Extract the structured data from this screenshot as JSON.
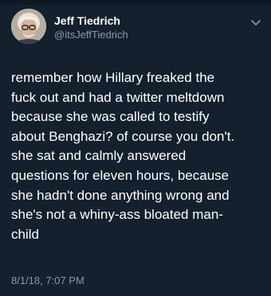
{
  "author": {
    "display_name": "Jeff Tiedrich",
    "handle": "@itsJeffTiedrich"
  },
  "tweet": {
    "lines": [
      "remember how Hillary freaked the",
      "fuck out and had a twitter meltdown",
      "because she was called to testify",
      "about Benghazi? of course you don't.",
      "she sat and calmly answered",
      "questions for eleven hours, because",
      "she hadn't done anything wrong and",
      "she's not a whiny-ass bloated man-",
      "child"
    ],
    "timestamp": "8/1/18, 7:07 PM"
  },
  "icons": {
    "avatar": "profile-photo",
    "menu": "chevron-down-icon"
  },
  "colors": {
    "background": "#14202e",
    "text": "#ffffff",
    "secondary_text": "#8899a6"
  }
}
